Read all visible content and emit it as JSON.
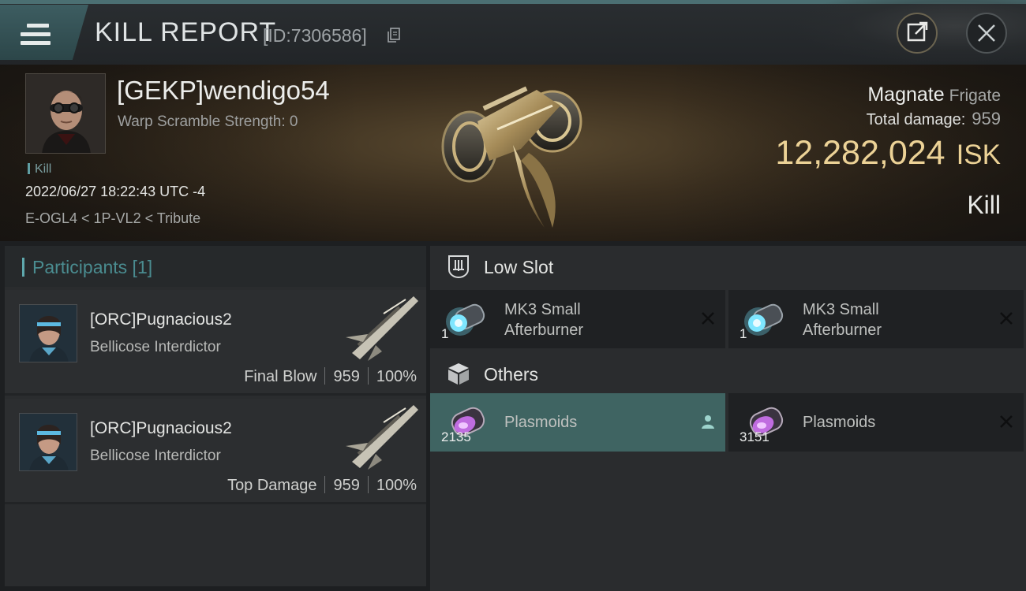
{
  "header": {
    "title": "KILL REPORT",
    "report_id": "[ID:7306586]"
  },
  "victim": {
    "name": "[GEKP]wendigo54",
    "warp_scramble": "Warp Scramble Strength: 0",
    "tag": "Kill",
    "timestamp": "2022/06/27 18:22:43 UTC -4",
    "location": "E-OGL4 < 1P-VL2 < Tribute",
    "ship_name": "Magnate",
    "ship_class": "Frigate",
    "total_damage_label": "Total damage:",
    "total_damage": "959",
    "isk_value": "12,282,024",
    "isk_unit": "ISK",
    "result": "Kill"
  },
  "participants": {
    "title": "Participants [1]",
    "items": [
      {
        "name": "[ORC]Pugnacious2",
        "ship": "Bellicose Interdictor",
        "role": "Final Blow",
        "damage": "959",
        "percent": "100%"
      },
      {
        "name": "[ORC]Pugnacious2",
        "ship": "Bellicose Interdictor",
        "role": "Top Damage",
        "damage": "959",
        "percent": "100%"
      }
    ]
  },
  "fitting": {
    "low_slot_label": "Low Slot",
    "others_label": "Others",
    "low_slot": [
      {
        "line1": "MK3 Small",
        "line2": "Afterburner",
        "qty": "1",
        "status": "destroyed"
      },
      {
        "line1": "MK3 Small",
        "line2": "Afterburner",
        "qty": "1",
        "status": "destroyed"
      }
    ],
    "others": [
      {
        "name": "Plasmoids",
        "qty": "2135",
        "status": "dropped"
      },
      {
        "name": "Plasmoids",
        "qty": "3151",
        "status": "destroyed"
      }
    ]
  },
  "colors": {
    "accent_teal": "#5ea8ad",
    "isk_gold": "#ecd296",
    "highlight_row": "#3f6462"
  }
}
